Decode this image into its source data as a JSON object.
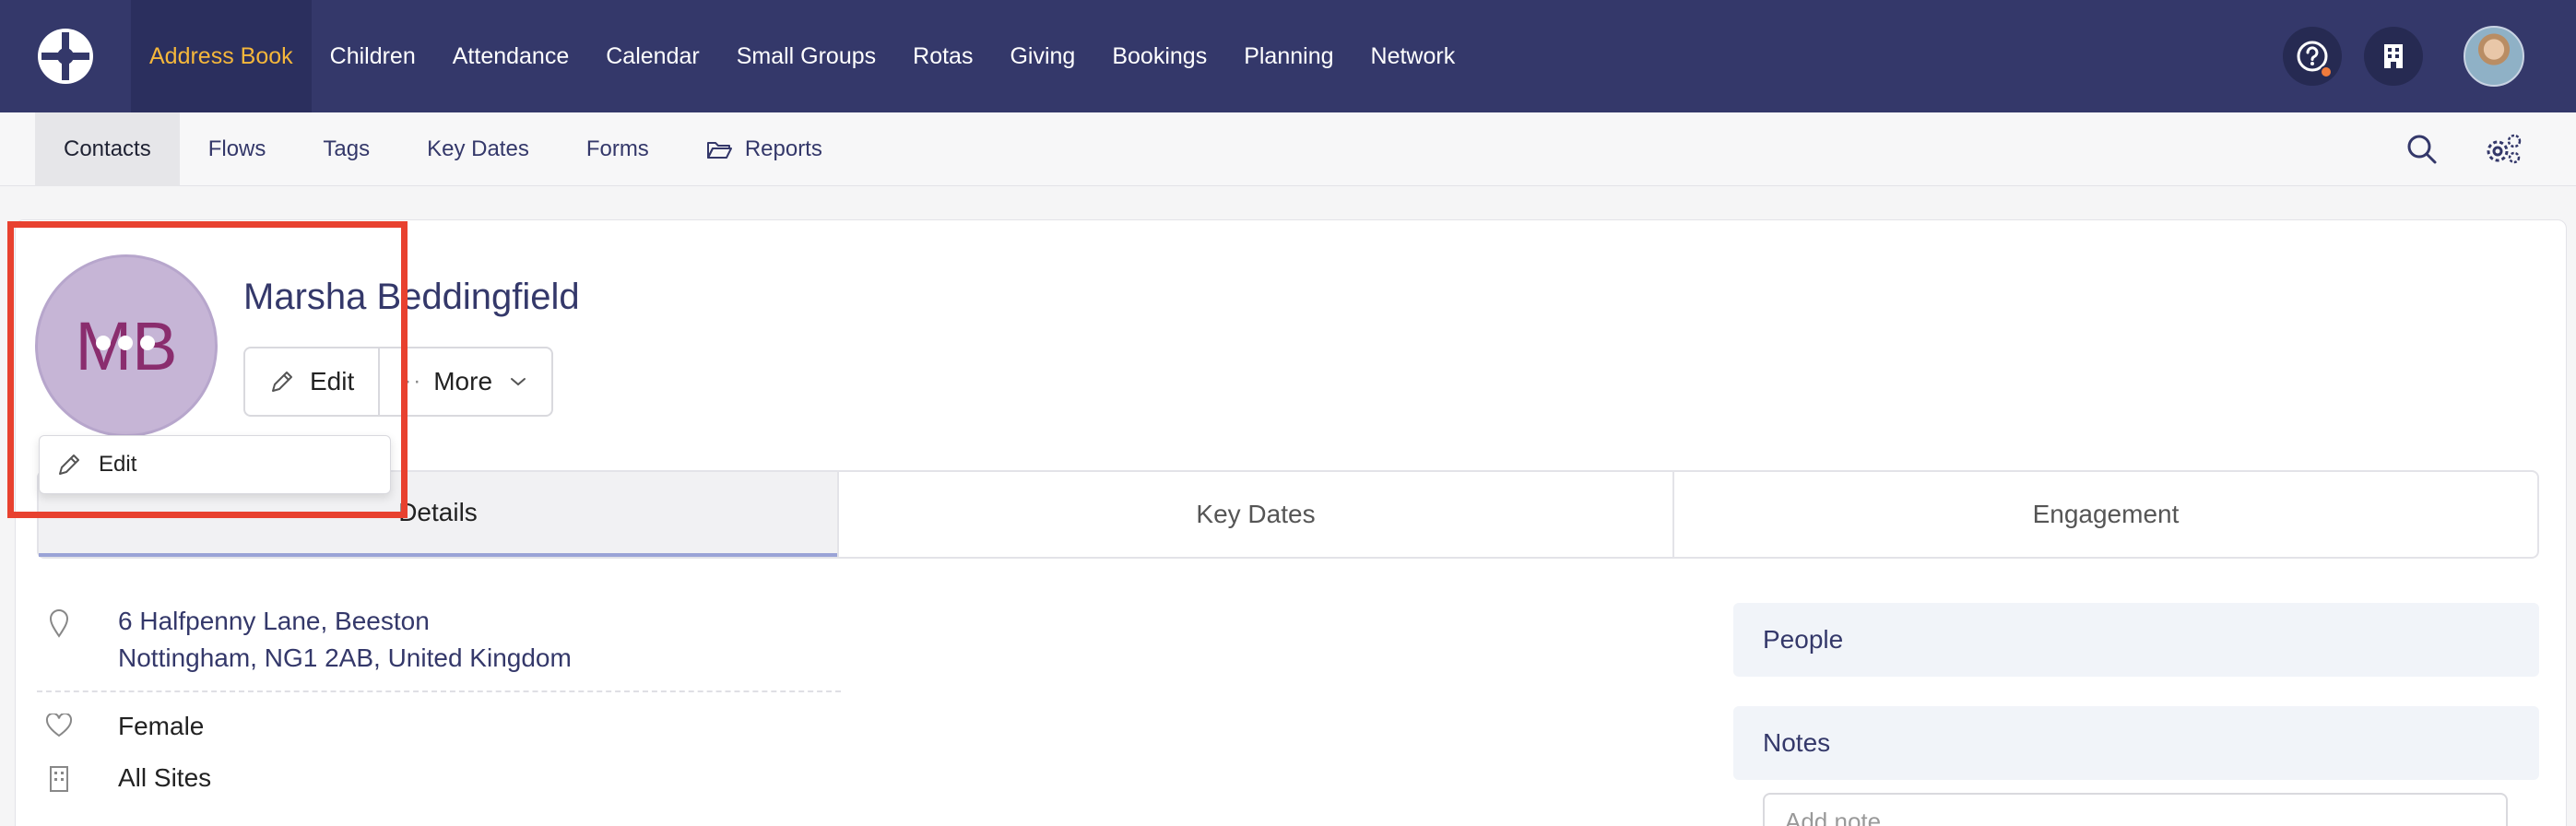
{
  "topnav": {
    "items": [
      "Address Book",
      "Children",
      "Attendance",
      "Calendar",
      "Small Groups",
      "Rotas",
      "Giving",
      "Bookings",
      "Planning",
      "Network"
    ],
    "active": "Address Book",
    "accent_color": "#f5b73b",
    "bg_color": "#34386a",
    "right_icons": [
      "help-icon",
      "building-icon",
      "user-avatar"
    ]
  },
  "subnav": {
    "items": [
      "Contacts",
      "Flows",
      "Tags",
      "Key Dates",
      "Forms",
      "Reports"
    ],
    "active": "Contacts",
    "right_icons": [
      "search-icon",
      "settings-icon"
    ]
  },
  "profile": {
    "initials": "MB",
    "name": "Marsha Beddingfield",
    "edit_label": "Edit",
    "more_label": "More",
    "popover_edit_label": "Edit"
  },
  "tabs": [
    "Details",
    "Key Dates",
    "Engagement"
  ],
  "active_tab": "Details",
  "details": {
    "address_line1": "6 Halfpenny Lane, Beeston",
    "address_line2": "Nottingham, NG1 2AB, United Kingdom",
    "gender": "Female",
    "site": "All Sites"
  },
  "side": {
    "people_label": "People",
    "notes_label": "Notes",
    "notes_placeholder": "Add note..."
  }
}
